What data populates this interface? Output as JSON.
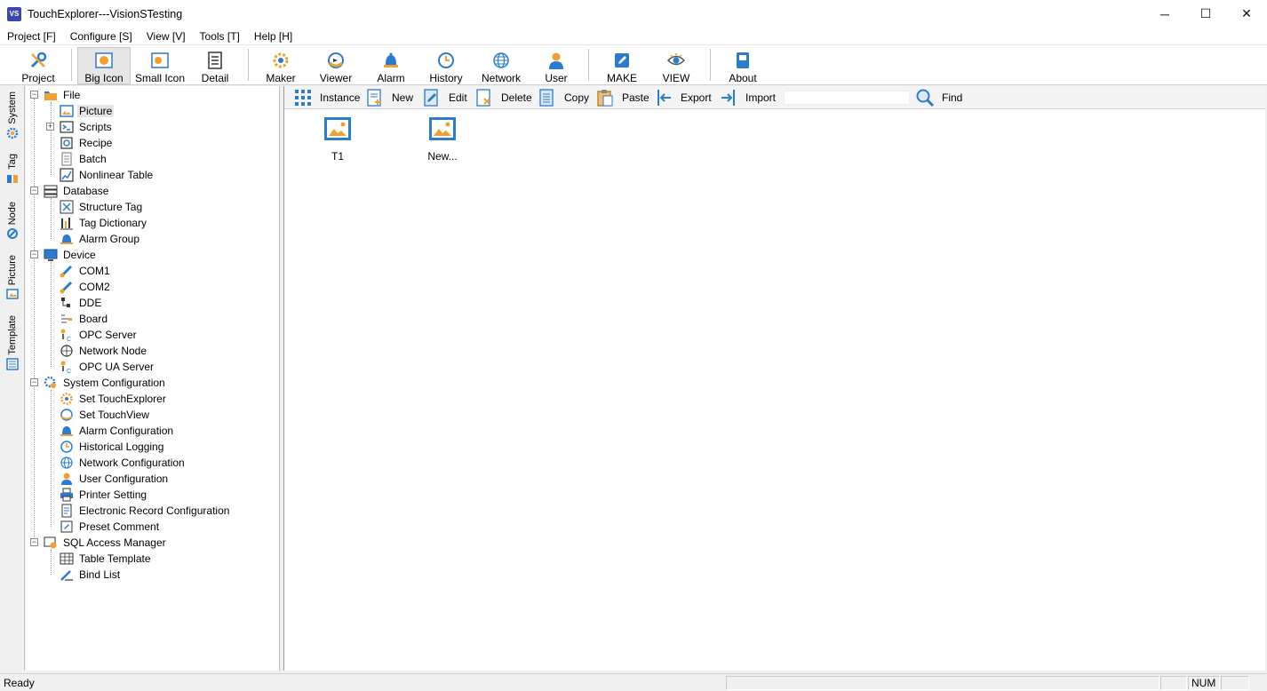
{
  "window": {
    "icon_text": "VS",
    "title": "TouchExplorer---VisionSTesting",
    "minimize": "─",
    "maximize": "☐",
    "close": "✕"
  },
  "menu": [
    "Project [F]",
    "Configure [S]",
    "View [V]",
    "Tools [T]",
    "Help [H]"
  ],
  "toolbar": {
    "project": "Project",
    "big_icon": "Big Icon",
    "small_icon": "Small Icon",
    "detail": "Detail",
    "maker": "Maker",
    "viewer": "Viewer",
    "alarm": "Alarm",
    "history": "History",
    "network": "Network",
    "user": "User",
    "make": "MAKE",
    "view": "VIEW",
    "about": "About"
  },
  "vtabs": [
    "System",
    "Tag",
    "Node",
    "Picture",
    "Template"
  ],
  "tree": {
    "file": "File",
    "picture": "Picture",
    "scripts": "Scripts",
    "recipe": "Recipe",
    "batch": "Batch",
    "nonlinear_table": "Nonlinear Table",
    "database": "Database",
    "structure_tag": "Structure Tag",
    "tag_dictionary": "Tag Dictionary",
    "alarm_group": "Alarm Group",
    "device": "Device",
    "com1": "COM1",
    "com2": "COM2",
    "dde": "DDE",
    "board": "Board",
    "opc_server": "OPC Server",
    "network_node": "Network Node",
    "opc_ua_server": "OPC UA Server",
    "system_configuration": "System Configuration",
    "set_touchexplorer": "Set TouchExplorer",
    "set_touchview": "Set TouchView",
    "alarm_configuration": "Alarm Configuration",
    "historical_logging": "Historical Logging",
    "network_configuration": "Network Configuration",
    "user_configuration": "User Configuration",
    "printer_setting": "Printer Setting",
    "electronic_record_configuration": "Electronic Record Configuration",
    "preset_comment": "Preset Comment",
    "sql_access_manager": "SQL Access Manager",
    "table_template": "Table Template",
    "bind_list": "Bind List"
  },
  "subbar": {
    "instance": "Instance",
    "new": "New",
    "edit": "Edit",
    "delete": "Delete",
    "copy": "Copy",
    "paste": "Paste",
    "export": "Export",
    "import": "Import",
    "find": "Find",
    "search_value": ""
  },
  "pictures": [
    "T1",
    "New..."
  ],
  "status": {
    "text": "Ready",
    "num": "NUM"
  },
  "colors": {
    "accent_blue": "#2b7bd0",
    "accent_orange": "#f0a030"
  }
}
